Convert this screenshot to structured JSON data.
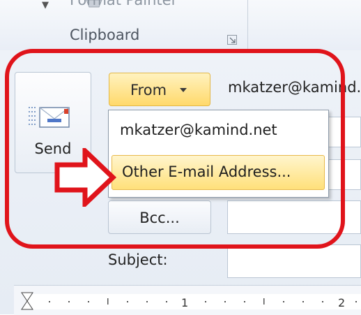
{
  "ribbon": {
    "partial_command": "Format Painter",
    "group_label": "Clipboard"
  },
  "compose": {
    "send_label": "Send",
    "from_label": "From",
    "from_address": "mkatzer@kamind.net",
    "bcc_label": "Bcc...",
    "subject_label": "Subject:"
  },
  "from_menu": {
    "items": [
      {
        "label": "mkatzer@kamind.net"
      },
      {
        "label": "Other E-mail Address..."
      }
    ]
  },
  "ruler": {
    "mark_1": "1",
    "mark_2": "2"
  },
  "colors": {
    "annotation": "#e0141b",
    "hover_gold": "#ffd96b"
  },
  "icons": [
    "chevron-down-icon",
    "format-painter-icon",
    "dialog-launcher-icon",
    "send-mail-icon",
    "dropdown-caret-icon",
    "pointer-arrow-icon"
  ]
}
